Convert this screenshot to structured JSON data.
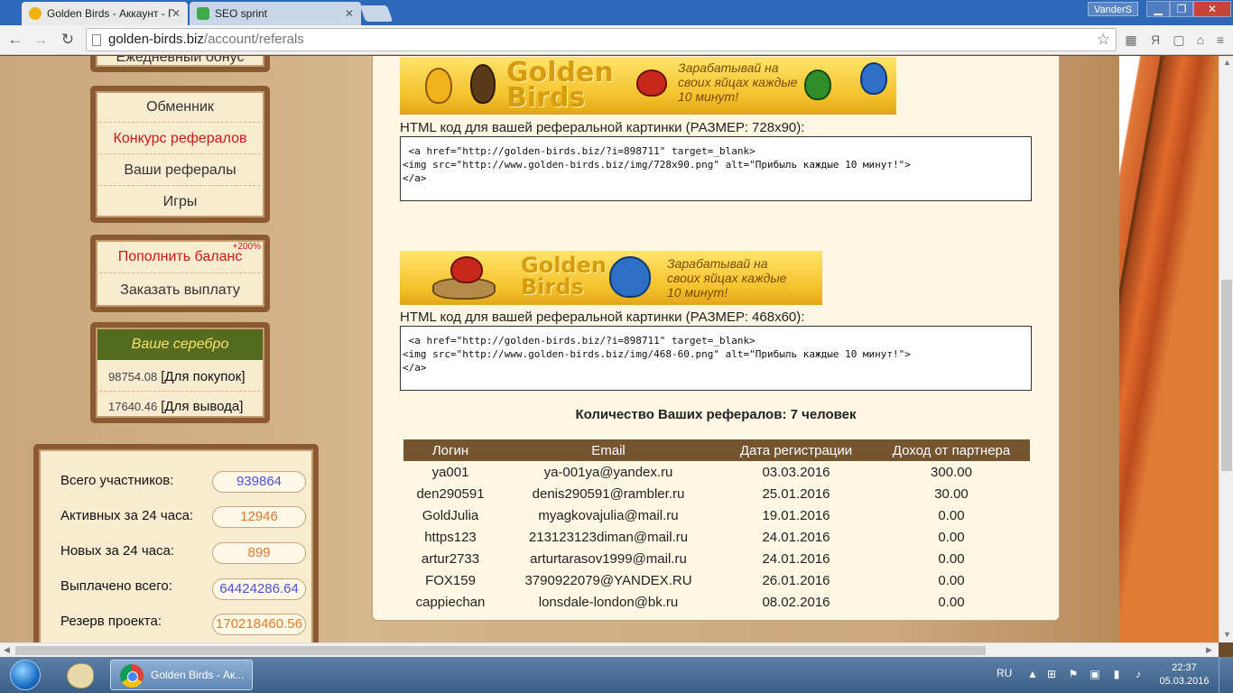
{
  "browser": {
    "tabs": [
      {
        "title": "Golden Birds - Аккаунт - Г",
        "active": true
      },
      {
        "title": "SEO sprint",
        "active": false
      }
    ],
    "user": "VanderS",
    "url_domain": "golden-birds.biz",
    "url_path": "/account/referals",
    "toolbar_letter": "Я"
  },
  "sidebar": {
    "top_cut_text": "Ежедневный бонус",
    "menu": [
      {
        "label": "Обменник",
        "highlight": false
      },
      {
        "label": "Конкурс рефералов",
        "highlight": true
      },
      {
        "label": "Ваши рефералы",
        "highlight": false
      },
      {
        "label": "Игры",
        "highlight": false
      }
    ],
    "balance": {
      "deposit": "Пополнить баланс",
      "bonus": "+200%",
      "withdraw": "Заказать выплату"
    },
    "silver": {
      "title": "Ваше серебро",
      "purchase_value": "98754.08",
      "purchase_label": "[Для покупок]",
      "withdraw_value": "17640.46",
      "withdraw_label": "[Для вывода]"
    },
    "stats": [
      {
        "label": "Всего участников:",
        "value": "939864",
        "color": "blue"
      },
      {
        "label": "Активных за 24 часа:",
        "value": "12946",
        "color": "orange"
      },
      {
        "label": "Новых за 24 часа:",
        "value": "899",
        "color": "orange"
      },
      {
        "label": "Выплачено всего:",
        "value": "64424286.64",
        "color": "blue"
      },
      {
        "label": "Резерв проекта:",
        "value": "170218460.56",
        "color": "orange"
      }
    ]
  },
  "main": {
    "banner_large": {
      "logo_1": "Golden",
      "logo_2": "Birds",
      "slogan": "Зарабатывай на своих яйцах каждые 10 минут!"
    },
    "label_728": "HTML код для вашей реферальной картинки (РАЗМЕР: 728x90):",
    "code_728": " <a href=\"http://golden-birds.biz/?i=898711\" target=_blank>\n<img src=\"http://www.golden-birds.biz/img/728x90.png\" alt=\"Прибыль каждые 10 минут!\">\n</a>",
    "banner_small": {
      "logo_1": "Golden",
      "logo_2": "Birds",
      "slogan": "Зарабатывай на своих яйцах каждые 10 минут!"
    },
    "label_468": "HTML код для вашей реферальной картинки (РАЗМЕР: 468x60):",
    "code_468": " <a href=\"http://golden-birds.biz/?i=898711\" target=_blank>\n<img src=\"http://www.golden-birds.biz/img/468-60.png\" alt=\"Прибыль каждые 10 минут!\">\n</a>",
    "ref_count": "Количество Ваших рефералов: 7 человек",
    "table": {
      "headers": [
        "Логин",
        "Email",
        "Дата регистрации",
        "Доход от партнера"
      ],
      "rows": [
        [
          "ya001",
          "ya-001ya@yandex.ru",
          "03.03.2016",
          "300.00"
        ],
        [
          "den290591",
          "denis290591@rambler.ru",
          "25.01.2016",
          "30.00"
        ],
        [
          "GoldJulia",
          "myagkovajulia@mail.ru",
          "19.01.2016",
          "0.00"
        ],
        [
          "https123",
          "213123123diman@mail.ru",
          "24.01.2016",
          "0.00"
        ],
        [
          "artur2733",
          "arturtarasov1999@mail.ru",
          "24.01.2016",
          "0.00"
        ],
        [
          "FOX159",
          "3790922079@YANDEX.RU",
          "26.01.2016",
          "0.00"
        ],
        [
          "cappiechan",
          "lonsdale-london@bk.ru",
          "08.02.2016",
          "0.00"
        ]
      ]
    }
  },
  "taskbar": {
    "active_item": "Golden Birds - Ак...",
    "lang": "RU",
    "time": "22:37",
    "date": "05.03.2016"
  },
  "colors": {
    "accent_red": "#d21616",
    "header_brown": "#75552f",
    "silver_green": "#556b1f"
  }
}
